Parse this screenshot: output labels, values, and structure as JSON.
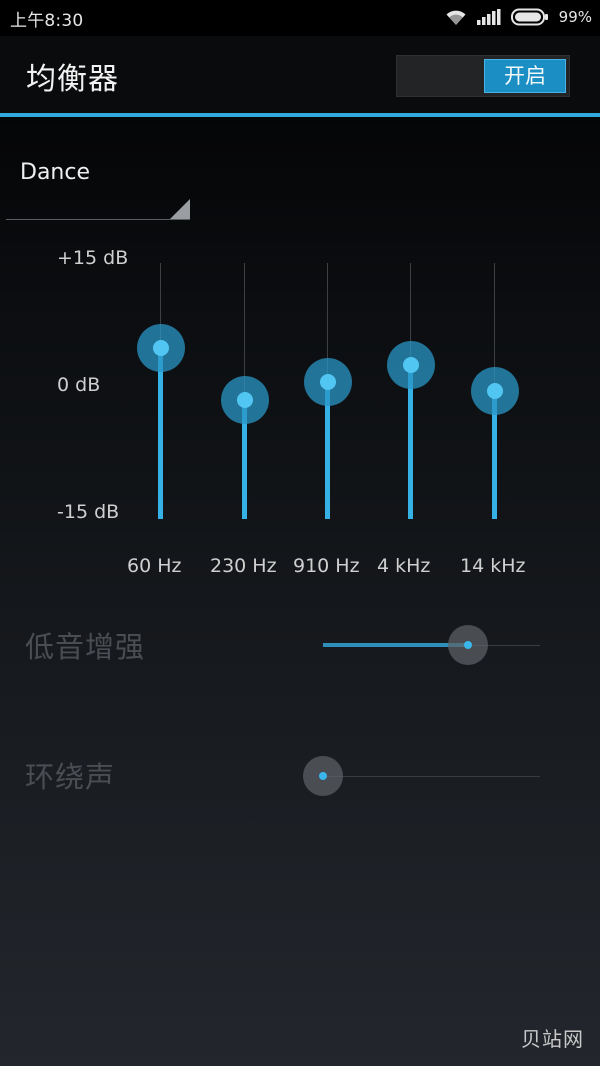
{
  "status_bar": {
    "time": "上午8:30",
    "battery_percent": "99%",
    "icons": [
      "wifi-icon",
      "signal-icon",
      "battery-icon"
    ]
  },
  "header": {
    "title": "均衡器",
    "toggle_label": "开启",
    "toggle_on": true
  },
  "preset": {
    "label": "Dance"
  },
  "equalizer": {
    "db_labels": {
      "top": "+15 dB",
      "mid": "0 dB",
      "bottom": "-15 dB"
    },
    "range_db": [
      -15,
      15
    ],
    "bands": [
      {
        "label": "60 Hz",
        "gain_db": 5
      },
      {
        "label": "230 Hz",
        "gain_db": -1
      },
      {
        "label": "910 Hz",
        "gain_db": 1
      },
      {
        "label": "4 kHz",
        "gain_db": 3
      },
      {
        "label": "14 kHz",
        "gain_db": 0
      }
    ]
  },
  "bass_boost": {
    "label": "低音增强",
    "value_fraction": 0.67
  },
  "surround": {
    "label": "环绕声",
    "value_fraction": 0.0
  },
  "watermark": "贝站网",
  "colors": {
    "accent": "#33a8dc",
    "accent_light": "#52c6f2",
    "disabled_text": "#4a4e53"
  }
}
